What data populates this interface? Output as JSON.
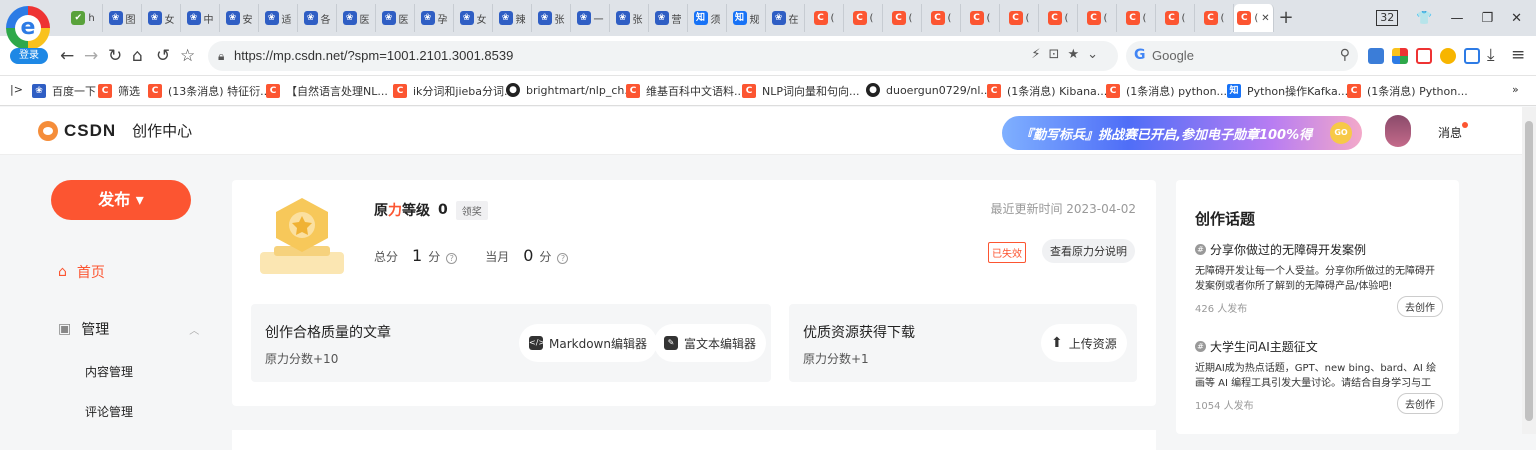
{
  "browser": {
    "login_label": "登录",
    "tabs": [
      {
        "icon": "hao",
        "text": "h"
      },
      {
        "icon": "paw",
        "text": "图"
      },
      {
        "icon": "paw",
        "text": "女"
      },
      {
        "icon": "paw",
        "text": "中"
      },
      {
        "icon": "paw",
        "text": "安"
      },
      {
        "icon": "paw",
        "text": "适"
      },
      {
        "icon": "paw",
        "text": "各"
      },
      {
        "icon": "paw",
        "text": "医"
      },
      {
        "icon": "paw",
        "text": "医"
      },
      {
        "icon": "paw",
        "text": "孕"
      },
      {
        "icon": "paw",
        "text": "女"
      },
      {
        "icon": "paw",
        "text": "辣"
      },
      {
        "icon": "paw",
        "text": "张"
      },
      {
        "icon": "paw",
        "text": "一"
      },
      {
        "icon": "paw",
        "text": "张"
      },
      {
        "icon": "paw",
        "text": "营"
      },
      {
        "icon": "zhi",
        "text": "须"
      },
      {
        "icon": "zhi",
        "text": "规"
      },
      {
        "icon": "paw",
        "text": "在"
      },
      {
        "icon": "c",
        "text": "("
      },
      {
        "icon": "c",
        "text": "("
      },
      {
        "icon": "c",
        "text": "("
      },
      {
        "icon": "c",
        "text": "("
      },
      {
        "icon": "c",
        "text": "("
      },
      {
        "icon": "c",
        "text": "("
      },
      {
        "icon": "c",
        "text": "("
      },
      {
        "icon": "c",
        "text": "("
      },
      {
        "icon": "c",
        "text": "("
      },
      {
        "icon": "c",
        "text": "("
      },
      {
        "icon": "c",
        "text": "("
      },
      {
        "icon": "c",
        "text": "("
      }
    ],
    "tab_count": "32",
    "url": "https://mp.csdn.net/?spm=1001.2101.3001.8539",
    "search_placeholder": "Google",
    "bookmarks": [
      {
        "icon": "paw",
        "label": "百度一下"
      },
      {
        "icon": "c",
        "label": "筛选"
      },
      {
        "icon": "c",
        "label": "(13条消息) 特征衍..."
      },
      {
        "icon": "c",
        "label": "【自然语言处理NL..."
      },
      {
        "icon": "c",
        "label": "ik分词和jieba分词..."
      },
      {
        "icon": "gh",
        "label": "brightmart/nlp_ch..."
      },
      {
        "icon": "c",
        "label": "维基百科中文语料..."
      },
      {
        "icon": "c",
        "label": "NLP词向量和句向..."
      },
      {
        "icon": "gh",
        "label": "duoergun0729/nl..."
      },
      {
        "icon": "c",
        "label": "(1条消息) Kibana..."
      },
      {
        "icon": "c",
        "label": "(1条消息) python..."
      },
      {
        "icon": "zhi",
        "label": "Python操作Kafka..."
      },
      {
        "icon": "c",
        "label": "(1条消息) Python..."
      }
    ]
  },
  "header": {
    "logo_text": "CSDN",
    "section_title": "创作中心",
    "banner_text": "『勤写标兵』挑战赛已开启,参加电子勋章100%得",
    "banner_coin": "GO",
    "message_label": "消息"
  },
  "sidebar": {
    "publish_label": "发布",
    "home_label": "首页",
    "manage_label": "管理",
    "sub_items": [
      "内容管理",
      "评论管理"
    ]
  },
  "level_card": {
    "level_title_1": "原",
    "level_title_accent": "力",
    "level_title_2": "等级",
    "level_value": "0",
    "claim_tag": "领奖",
    "total_label": "总分",
    "total_value": "1",
    "month_label": "当月",
    "month_value": "0",
    "unit": "分",
    "updated_text": "最近更新时间 2023-04-02",
    "expired_tag": "已失效",
    "explain_button": "查看原力分说明",
    "article_box": {
      "title": "创作合格质量的文章",
      "subtitle": "原力分数+10",
      "markdown_button": "Markdown编辑器",
      "richtext_button": "富文本编辑器"
    },
    "resource_box": {
      "title": "优质资源获得下载",
      "subtitle": "原力分数+1",
      "upload_button": "上传资源"
    }
  },
  "topics": {
    "title": "创作话题",
    "items": [
      {
        "title": "分享你做过的无障碍开发案例",
        "desc": "无障碍开发让每一个人受益。分享你所做过的无障碍开发案例或者你所了解到的无障碍产品/体验吧!",
        "count": "426 人发布",
        "button": "去创作"
      },
      {
        "title": "大学生问AI主题征文",
        "desc": "近期AI成为热点话题，GPT、new bing、bard、AI 绘画等 AI 编程工具引发大量讨论。请结合自身学习与工作...",
        "count": "1054 人发布",
        "button": "去创作"
      }
    ]
  },
  "colors": {
    "accent": "#fc5531",
    "tabbar": "#dfe3e8",
    "page_bg": "#f5f6f7"
  }
}
